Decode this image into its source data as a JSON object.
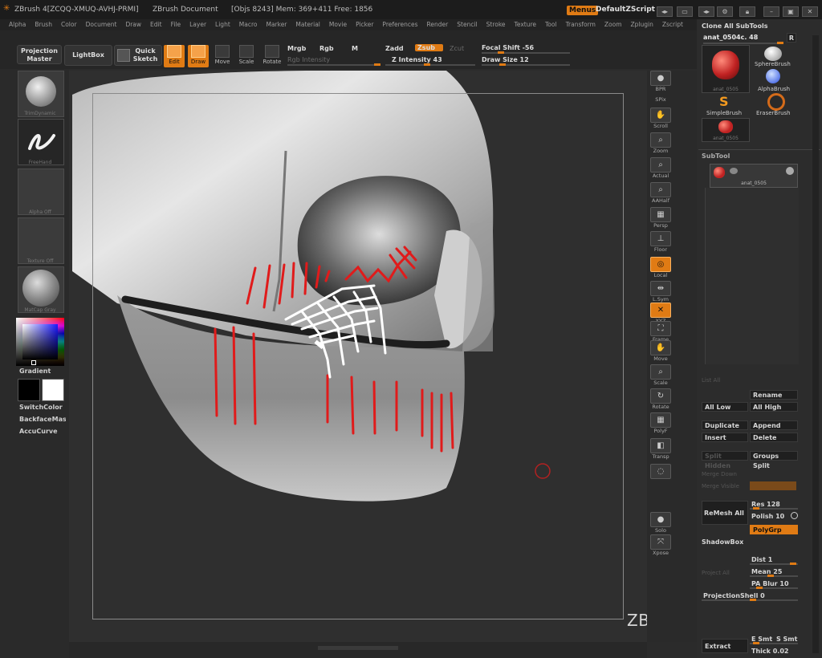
{
  "titlebar": {
    "app": "ZBrush 4[ZCQQ-XMUQ-AVHJ-PRMI]",
    "document": "ZBrush Document",
    "stats": "[Objs 8243] Mem: 369+411 Free: 1856",
    "menus_button": "Menus",
    "script_label": "DefaultZScript"
  },
  "menubar": [
    "Alpha",
    "Brush",
    "Color",
    "Document",
    "Draw",
    "Edit",
    "File",
    "Layer",
    "Light",
    "Macro",
    "Marker",
    "Material",
    "Movie",
    "Picker",
    "Preferences",
    "Render",
    "Stencil",
    "Stroke",
    "Texture",
    "Tool",
    "Transform",
    "Zoom",
    "Zplugin",
    "Zscript"
  ],
  "toolbar": {
    "projection_master": "Projection Master",
    "lightbox": "LightBox",
    "quick_sketch": "Quick Sketch",
    "edit": "Edit",
    "draw": "Draw",
    "move": "Move",
    "scale": "Scale",
    "rotate": "Rotate",
    "mrgb": "Mrgb",
    "rgb": "Rgb",
    "m": "M",
    "rgb_intensity": "Rgb Intensity",
    "zadd": "Zadd",
    "zsub": "Zsub",
    "zcut": "Zcut",
    "z_intensity": "Z Intensity 43",
    "focal_shift": "Focal Shift -56",
    "draw_size": "Draw Size 12"
  },
  "leftshelf": {
    "brush_caption": "TrimDynamic",
    "stroke_caption": "FreeHand",
    "alpha_caption": "Alpha Off",
    "texture_caption": "Texture Off",
    "material_caption": "MatCap Gray",
    "gradient": "Gradient",
    "switch_color": "SwitchColor",
    "backface": "BackfaceMask",
    "accucurve": "AccuCurve"
  },
  "viewport": {
    "watermark": "ZBrushWorkshops"
  },
  "rightcol": [
    {
      "name": "bpr-button",
      "label": "BPR",
      "glyph": "●",
      "on": false
    },
    {
      "name": "spix-label",
      "label": "SPix",
      "glyph": "",
      "on": false
    },
    {
      "name": "scroll-button",
      "label": "Scroll",
      "glyph": "✋",
      "on": false
    },
    {
      "name": "zoom-button",
      "label": "Zoom",
      "glyph": "⌕",
      "on": false
    },
    {
      "name": "actual-button",
      "label": "Actual",
      "glyph": "⌕",
      "on": false
    },
    {
      "name": "aahalf-button",
      "label": "AAHalf",
      "glyph": "⌕",
      "on": false
    },
    {
      "name": "persp-button",
      "label": "Persp",
      "glyph": "▦",
      "on": false
    },
    {
      "name": "floor-button",
      "label": "Floor",
      "glyph": "⊥",
      "on": false
    },
    {
      "name": "local-button",
      "label": "Local",
      "glyph": "◎",
      "on": true
    },
    {
      "name": "lsym-button",
      "label": "L.Sym",
      "glyph": "⇹",
      "on": false
    },
    {
      "name": "xyz-button",
      "label": "XYZ",
      "glyph": "✕",
      "on": true
    },
    {
      "name": "frame-button",
      "label": "Frame",
      "glyph": "⛶",
      "on": false
    },
    {
      "name": "move-view-button",
      "label": "Move",
      "glyph": "✋",
      "on": false
    },
    {
      "name": "scale-view-button",
      "label": "Scale",
      "glyph": "⌕",
      "on": false
    },
    {
      "name": "rotate-view-button",
      "label": "Rotate",
      "glyph": "↻",
      "on": false
    },
    {
      "name": "polyf-button",
      "label": "PolyF",
      "glyph": "▦",
      "on": false
    },
    {
      "name": "transp-button",
      "label": "Transp",
      "glyph": "◧",
      "on": false
    },
    {
      "name": "ghost-button",
      "label": "",
      "glyph": "◌",
      "on": false
    },
    {
      "name": "solo-button",
      "label": "Solo",
      "glyph": "●",
      "on": false
    },
    {
      "name": "xpose-button",
      "label": "Xpose",
      "glyph": "⤧",
      "on": false
    }
  ],
  "rightpanel": {
    "clone_all": "Clone All SubTools",
    "tool_name": "anat_0504c. 48",
    "r_button": "R",
    "current_tool_caption": "anat_0505",
    "sphere_brush": "SphereBrush",
    "alpha_brush": "AlphaBrush",
    "simple_brush": "SimpleBrush",
    "eraser_brush": "EraserBrush",
    "tool_thumb_caption": "anat_0505",
    "subtool_header": "SubTool",
    "subtool_item": "anat_0505",
    "list_all": "List All",
    "rename": "Rename",
    "all_low": "All Low",
    "all_high": "All High",
    "duplicate": "Duplicate",
    "append": "Append",
    "insert": "Insert",
    "delete": "Delete",
    "split_hidden": "Split Hidden",
    "groups_split": "Groups Split",
    "merge_down": "Merge Down",
    "merge_visible": "Merge Visible",
    "remesh_all": "ReMesh All",
    "res": "Res 128",
    "polish": "Polish 10",
    "polygrp": "PolyGrp",
    "shadowbox": "ShadowBox",
    "project_all": "Project All",
    "dist": "Dist 1",
    "mean": "Mean 25",
    "pa_blur": "PA Blur 10",
    "projection_shell": "ProjectionShell 0",
    "extract": "Extract",
    "e_smt": "E Smt",
    "s_smt": "S Smt",
    "thick": "Thick 0.02"
  }
}
